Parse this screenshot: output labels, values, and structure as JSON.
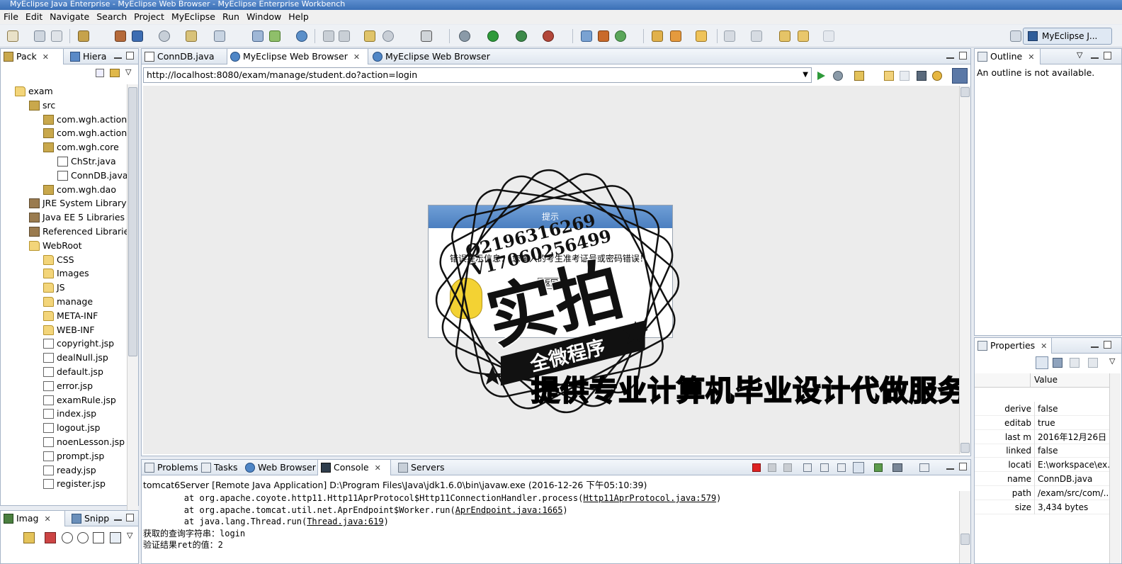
{
  "window": {
    "title": "MyEclipse Java Enterprise - MyEclipse Web Browser - MyEclipse Enterprise Workbench"
  },
  "menu": [
    "File",
    "Edit",
    "Navigate",
    "Search",
    "Project",
    "MyEclipse",
    "Run",
    "Window",
    "Help"
  ],
  "perspective": {
    "label": "MyEclipse J..."
  },
  "left_panel": {
    "tabs": [
      {
        "label": "Pack"
      },
      {
        "label": "Hiera"
      }
    ],
    "tree": [
      {
        "label": "exam",
        "icon": "project-icon"
      },
      {
        "label": "src",
        "icon": "source-folder-icon"
      },
      {
        "label": "com.wgh.action",
        "icon": "package-icon"
      },
      {
        "label": "com.wgh.actionF",
        "icon": "package-icon"
      },
      {
        "label": "com.wgh.core",
        "icon": "package-icon"
      },
      {
        "label": "ChStr.java",
        "icon": "java-file-icon"
      },
      {
        "label": "ConnDB.java",
        "icon": "java-file-icon"
      },
      {
        "label": "com.wgh.dao",
        "icon": "package-icon"
      },
      {
        "label": "JRE System Library",
        "icon": "library-icon"
      },
      {
        "label": "Java EE 5 Libraries",
        "icon": "library-icon"
      },
      {
        "label": "Referenced Librarie",
        "icon": "library-icon"
      },
      {
        "label": "WebRoot",
        "icon": "folder-icon"
      },
      {
        "label": "CSS",
        "icon": "folder-icon"
      },
      {
        "label": "Images",
        "icon": "folder-icon"
      },
      {
        "label": "JS",
        "icon": "folder-icon"
      },
      {
        "label": "manage",
        "icon": "folder-icon"
      },
      {
        "label": "META-INF",
        "icon": "folder-icon"
      },
      {
        "label": "WEB-INF",
        "icon": "folder-icon"
      },
      {
        "label": "copyright.jsp",
        "icon": "jsp-file-icon"
      },
      {
        "label": "dealNull.jsp",
        "icon": "jsp-file-icon"
      },
      {
        "label": "default.jsp",
        "icon": "jsp-file-icon"
      },
      {
        "label": "error.jsp",
        "icon": "jsp-file-icon"
      },
      {
        "label": "examRule.jsp",
        "icon": "jsp-file-icon"
      },
      {
        "label": "index.jsp",
        "icon": "jsp-file-icon"
      },
      {
        "label": "logout.jsp",
        "icon": "jsp-file-icon"
      },
      {
        "label": "noenLesson.jsp",
        "icon": "jsp-file-icon"
      },
      {
        "label": "prompt.jsp",
        "icon": "jsp-file-icon"
      },
      {
        "label": "ready.jsp",
        "icon": "jsp-file-icon"
      },
      {
        "label": "register.jsp",
        "icon": "jsp-file-icon"
      }
    ]
  },
  "bottom_left": {
    "tabs": [
      {
        "label": "Imag"
      },
      {
        "label": "Snipp"
      }
    ]
  },
  "editor": {
    "tabs": [
      {
        "label": "ConnDB.java"
      },
      {
        "label": "MyEclipse Web Browser"
      },
      {
        "label": "MyEclipse Web Browser"
      }
    ],
    "url": "http://localhost:8080/exam/manage/student.do?action=login"
  },
  "dialog": {
    "title": "提示",
    "message": "错误提示信息：  您输入的考生准考证号或密码错误！",
    "button": "返回"
  },
  "watermark": {
    "qq": "Q2196316269",
    "vx": "V17060256499",
    "big": "实拍",
    "ribbon": "全微程序",
    "slogan": "提供专业计算机毕业设计代做服务"
  },
  "outline": {
    "tab": "Outline",
    "message": "An outline is not available."
  },
  "properties": {
    "tab": "Properties",
    "value_header": "Value",
    "rows": [
      {
        "key": "derive",
        "value": "false"
      },
      {
        "key": "editab",
        "value": "true"
      },
      {
        "key": "last m",
        "value": "2016年12月26日 ..."
      },
      {
        "key": "linked",
        "value": "false"
      },
      {
        "key": "locati",
        "value": "E:\\workspace\\ex..."
      },
      {
        "key": "name",
        "value": "ConnDB.java"
      },
      {
        "key": "path",
        "value": "/exam/src/com/..."
      },
      {
        "key": "size",
        "value": "3,434  bytes"
      }
    ]
  },
  "console": {
    "tabs": [
      {
        "label": "Problems"
      },
      {
        "label": "Tasks"
      },
      {
        "label": "Web Browser"
      },
      {
        "label": "Console"
      },
      {
        "label": "Servers"
      }
    ],
    "header": "tomcat6Server [Remote Java Application] D:\\Program Files\\Java\\jdk1.6.0\\bin\\javaw.exe (2016-12-26 下午05:10:39)",
    "lines": [
      {
        "pre": "        at org.apache.coyote.http11.Http11AprProtocol$Http11ConnectionHandler.process(",
        "link": "Http11AprProtocol.java:579",
        "post": ")"
      },
      {
        "pre": "        at org.apache.tomcat.util.net.AprEndpoint$Worker.run(",
        "link": "AprEndpoint.java:1665",
        "post": ")"
      },
      {
        "pre": "        at java.lang.Thread.run(",
        "link": "Thread.java:619",
        "post": ")"
      },
      {
        "pre": "获取的查询字符串：login",
        "link": "",
        "post": ""
      },
      {
        "pre": "验证结果ret的值：2",
        "link": "",
        "post": ""
      }
    ]
  }
}
